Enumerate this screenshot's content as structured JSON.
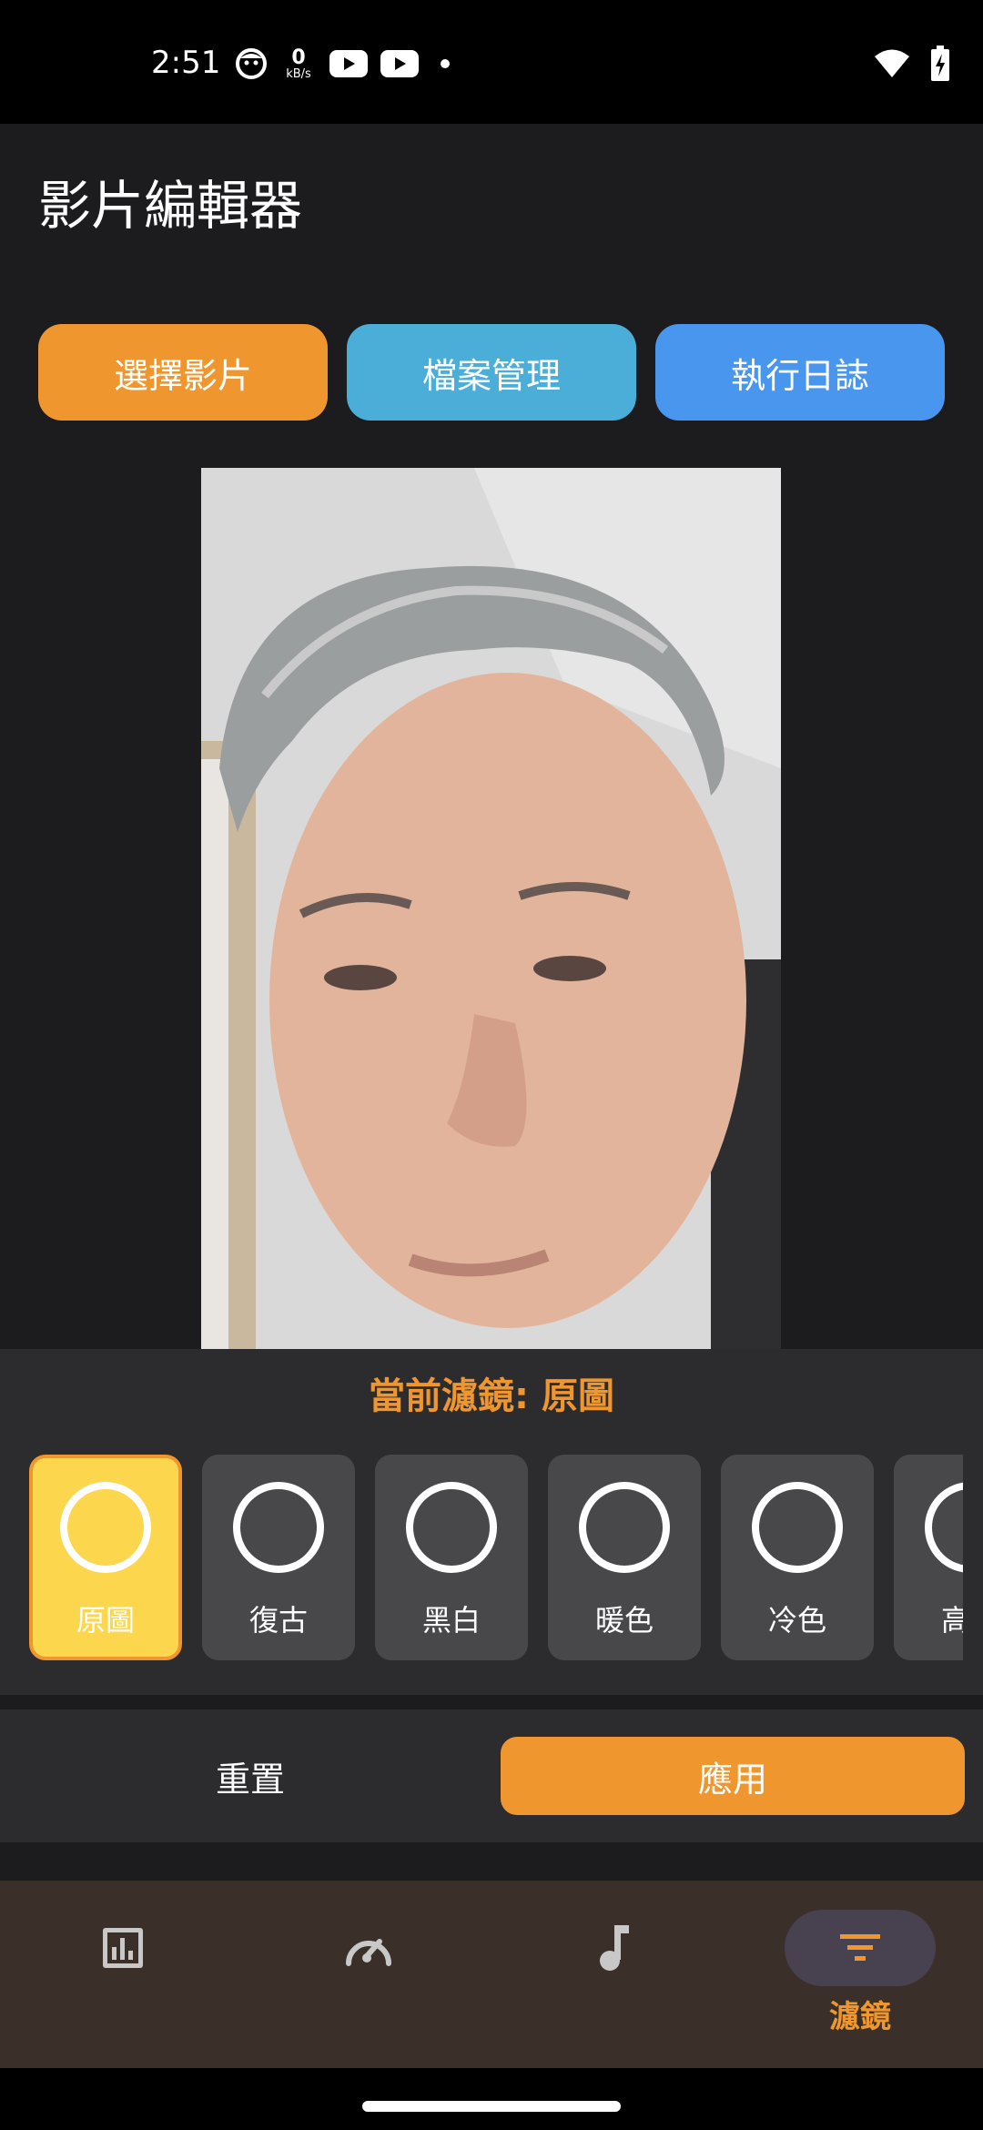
{
  "status_bar": {
    "time": "2:51",
    "net_speed_value": "0",
    "net_speed_unit": "kB/s",
    "left_icons": [
      "face-icon",
      "net-speed-icon",
      "youtube-icon",
      "youtube-icon",
      "dot-icon"
    ],
    "right_icons": [
      "wifi-icon",
      "battery-charging-icon"
    ]
  },
  "app": {
    "title": "影片編輯器",
    "buttons": [
      {
        "label": "選擇影片",
        "color": "#f0962e"
      },
      {
        "label": "檔案管理",
        "color": "#4aaed8"
      },
      {
        "label": "執行日誌",
        "color": "#4896ee"
      }
    ]
  },
  "filter_panel": {
    "current_filter_label": "當前濾鏡: 原圖",
    "filters": [
      {
        "label": "原圖",
        "selected": true
      },
      {
        "label": "復古",
        "selected": false
      },
      {
        "label": "黑白",
        "selected": false
      },
      {
        "label": "暖色",
        "selected": false
      },
      {
        "label": "冷色",
        "selected": false
      },
      {
        "label": "高對",
        "selected": false
      }
    ]
  },
  "actions": {
    "reset_label": "重置",
    "apply_label": "應用"
  },
  "bottom_nav": {
    "items": [
      {
        "icon": "bar-chart-icon",
        "label": ""
      },
      {
        "icon": "speed-gauge-icon",
        "label": ""
      },
      {
        "icon": "music-note-icon",
        "label": ""
      },
      {
        "icon": "filter-icon",
        "label": "濾鏡",
        "active": true
      }
    ]
  },
  "colors": {
    "accent": "#f0962e",
    "selected_filter": "#fcd64d",
    "background": "#1c1c1e",
    "panel": "#2c2c2e",
    "nav_background": "#3a3029"
  }
}
